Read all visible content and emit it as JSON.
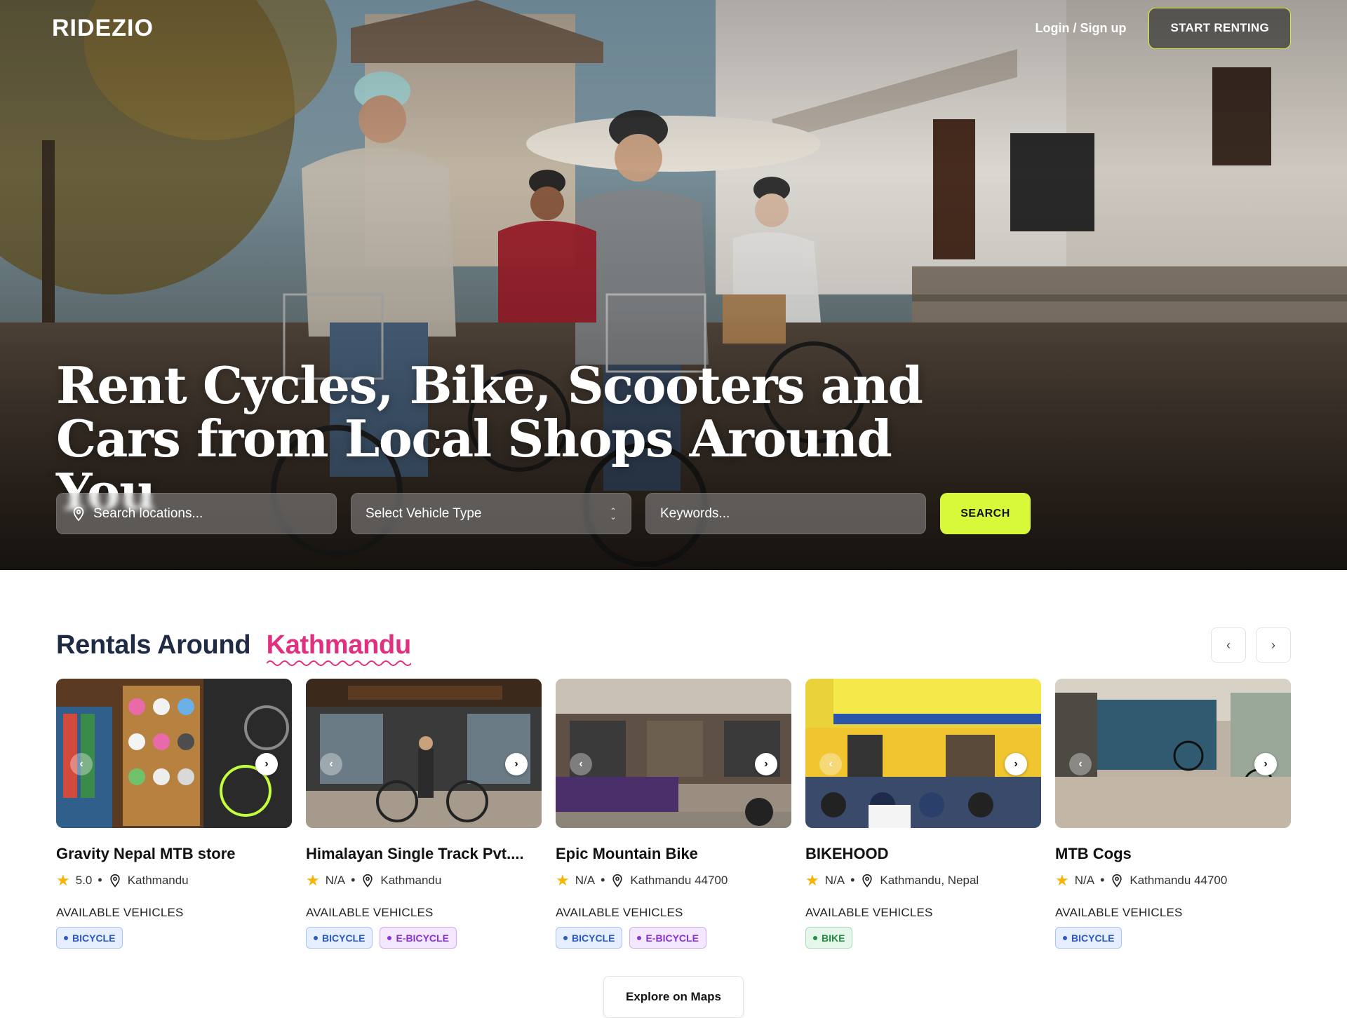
{
  "brand": {
    "logo": "RIDEZIO"
  },
  "nav": {
    "login_label": "Login / Sign up",
    "start_label": "START RENTING"
  },
  "hero": {
    "title_line1": "Rent Cycles, Bike, Scooters and",
    "title_line2": "Cars from Local Shops Around You"
  },
  "search": {
    "location_placeholder": "Search locations...",
    "vehicle_placeholder": "Select Vehicle Type",
    "keywords_placeholder": "Keywords...",
    "button_label": "SEARCH"
  },
  "rentals": {
    "title": "Rentals Around",
    "city": "Kathmandu",
    "available_label": "AVAILABLE VEHICLES",
    "shops": [
      {
        "name": "Gravity Nepal MTB store",
        "rating": "5.0",
        "location": "Kathmandu",
        "tags": [
          "BICYCLE"
        ]
      },
      {
        "name": "Himalayan Single Track Pvt....",
        "rating": "N/A",
        "location": "Kathmandu",
        "tags": [
          "BICYCLE",
          "E-BICYCLE"
        ]
      },
      {
        "name": "Epic Mountain Bike",
        "rating": "N/A",
        "location": "Kathmandu 44700",
        "tags": [
          "BICYCLE",
          "E-BICYCLE"
        ]
      },
      {
        "name": "BIKEHOOD",
        "rating": "N/A",
        "location": "Kathmandu, Nepal",
        "tags": [
          "BIKE"
        ]
      },
      {
        "name": "MTB Cogs",
        "rating": "N/A",
        "location": "Kathmandu 44700",
        "tags": [
          "BICYCLE"
        ]
      }
    ]
  },
  "explore_label": "Explore on Maps",
  "colors": {
    "accent_lime": "#d8f93a",
    "accent_pink": "#e0307e",
    "title_navy": "#1f2a44"
  },
  "icons": {
    "location": "map-pin-icon",
    "rating": "star-icon",
    "prev": "chevron-left-icon",
    "next": "chevron-right-icon"
  }
}
